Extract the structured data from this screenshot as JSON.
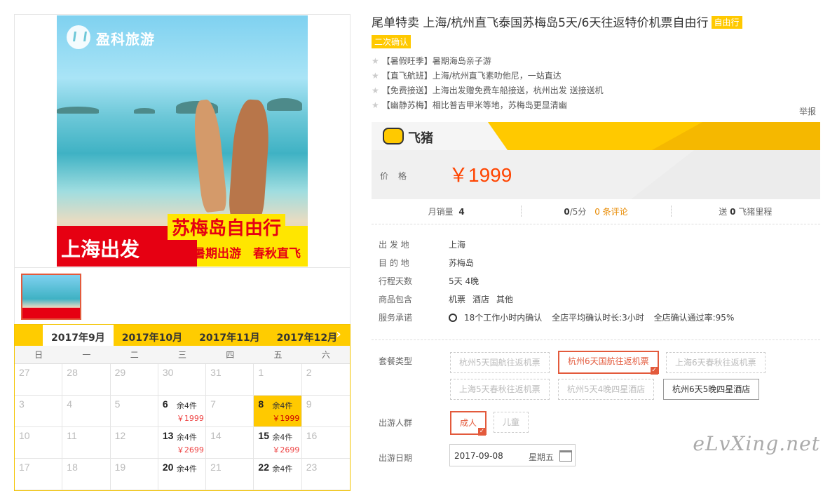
{
  "product": {
    "title": "尾单特卖 上海/杭州直飞泰国苏梅岛5天/6天往返特价机票自由行",
    "tag_type": "自由行",
    "tag_confirm": "二次确认",
    "report": "举报"
  },
  "image": {
    "brand": "盈科旅游",
    "banner_left": "上海出发",
    "banner_title": "苏梅岛自由行",
    "banner_sub": "暑期出游　春秋直飞"
  },
  "features": [
    "【暑假旺季】暑期海岛亲子游",
    "【直飞航班】上海/杭州直飞素叻他尼，一站直达",
    "【免费接送】上海出发赠免费车船接送，杭州出发 送接送机",
    "【幽静苏梅】相比普吉甲米等地，苏梅岛更显清幽"
  ],
  "store": {
    "name": "飞猪"
  },
  "price": {
    "label": "价格",
    "value": "￥1999"
  },
  "stats": {
    "sales_label": "月销量",
    "sales_value": "4",
    "rating_value": "0",
    "rating_suffix": "/5分",
    "reviews": "0 条评论",
    "mileage_prefix": "送",
    "mileage_value": "0",
    "mileage_suffix": "飞猪里程"
  },
  "info": {
    "departure_label": "出 发 地",
    "departure": "上海",
    "destination_label": "目 的 地",
    "destination": "苏梅岛",
    "days_label": "行程天数",
    "days": "5天 4晚",
    "includes_label": "商品包含",
    "includes": [
      "机票",
      "酒店",
      "其他"
    ],
    "promise_label": "服务承诺",
    "promise_1": "18个工作小时内确认",
    "promise_2": "全店平均确认时长:3小时",
    "promise_3": "全店确认通过率:95%"
  },
  "package": {
    "label": "套餐类型",
    "options": [
      "杭州5天国航往返机票",
      "杭州6天国航往返机票",
      "上海6天春秋往返机票",
      "上海5天春秋往返机票",
      "杭州5天4晚四星酒店",
      "杭州6天5晚四星酒店"
    ]
  },
  "travelers": {
    "label": "出游人群",
    "options": [
      "成人",
      "儿童"
    ]
  },
  "date": {
    "label": "出游日期",
    "value": "2017-09-08",
    "weekday": "星期五"
  },
  "calendar": {
    "tabs": [
      "2017年9月",
      "2017年10月",
      "2017年11月",
      "2017年12月"
    ],
    "next": "›",
    "weekdays": [
      "日",
      "一",
      "二",
      "三",
      "四",
      "五",
      "六"
    ],
    "cells": [
      {
        "d": "27"
      },
      {
        "d": "28"
      },
      {
        "d": "29"
      },
      {
        "d": "30"
      },
      {
        "d": "31"
      },
      {
        "d": "1"
      },
      {
        "d": "2"
      },
      {
        "d": "3"
      },
      {
        "d": "4"
      },
      {
        "d": "5"
      },
      {
        "d": "6",
        "stock": "余4件",
        "price": "￥1999"
      },
      {
        "d": "7"
      },
      {
        "d": "8",
        "stock": "余4件",
        "price": "￥1999",
        "sel": true
      },
      {
        "d": "9"
      },
      {
        "d": "10"
      },
      {
        "d": "11"
      },
      {
        "d": "12"
      },
      {
        "d": "13",
        "stock": "余4件",
        "price": "￥2699"
      },
      {
        "d": "14"
      },
      {
        "d": "15",
        "stock": "余4件",
        "price": "￥2699"
      },
      {
        "d": "16"
      },
      {
        "d": "17"
      },
      {
        "d": "18"
      },
      {
        "d": "19"
      },
      {
        "d": "20",
        "stock": "余4件",
        "price": ""
      },
      {
        "d": "21"
      },
      {
        "d": "22",
        "stock": "余4件",
        "price": ""
      },
      {
        "d": "23"
      }
    ]
  },
  "watermark": "eLvXing.net",
  "colors": {
    "accent": "#ffc900",
    "price": "#ff4400",
    "selected": "#e35a3c"
  }
}
